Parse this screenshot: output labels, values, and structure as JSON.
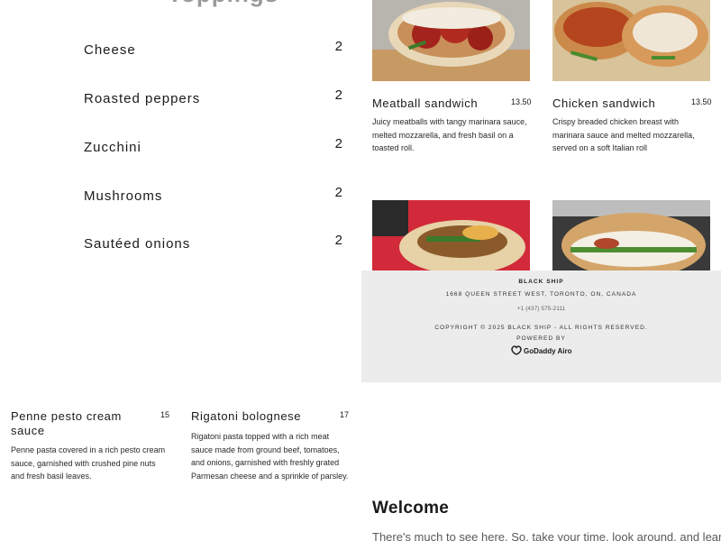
{
  "section": {
    "heading": "Toppings"
  },
  "toppings": [
    {
      "name": "Cheese",
      "price": "2"
    },
    {
      "name": "Roasted peppers",
      "price": "2"
    },
    {
      "name": "Zucchini",
      "price": "2"
    },
    {
      "name": "Mushrooms",
      "price": "2"
    },
    {
      "name": "Sautéed onions",
      "price": "2"
    }
  ],
  "sandwiches": [
    {
      "title": "Meatball sandwich",
      "price": "13.50",
      "description": "Juicy meatballs with tangy marinara sauce, melted mozzarella, and fresh basil on a toasted roll."
    },
    {
      "title": "Chicken sandwich",
      "price": "13.50",
      "description": "Crispy breaded chicken breast with marinara sauce and melted mozzarella, served on a soft Italian roll"
    }
  ],
  "pastas": [
    {
      "title": "Penne pesto cream sauce",
      "price": "15",
      "description": "Penne pasta covered in a rich pesto cream sauce, garnished with crushed pine nuts and fresh basil leaves."
    },
    {
      "title": "Rigatoni bolognese",
      "price": "17",
      "description": "Rigatoni pasta topped with a rich meat sauce made from ground beef, tomatoes, and onions, garnished with freshly grated Parmesan cheese and a sprinkle of parsley."
    }
  ],
  "footer": {
    "brand": "BLACK SHIP",
    "address": "1668 QUEEN STREET WEST, TORONTO, ON, CANADA",
    "phone": "+1 (437) 575-2111",
    "copyright": "COPYRIGHT © 2025 BLACK SHIP - ALL RIGHTS RESERVED.",
    "powered_by": "POWERED BY",
    "logo_text": "GoDaddy Airo"
  },
  "welcome": {
    "title": "Welcome",
    "text": "There's much to see here. So, take your time, look around, and learn all"
  },
  "colors": {
    "footer_bg": "#ececec",
    "heading_gray": "#9a9a9a",
    "text_dark": "#1a1a1a"
  },
  "icons": [
    "meatball-sandwich-photo",
    "chicken-sandwich-photo",
    "wrap-photo",
    "panini-photo",
    "godaddy-logo-icon"
  ]
}
